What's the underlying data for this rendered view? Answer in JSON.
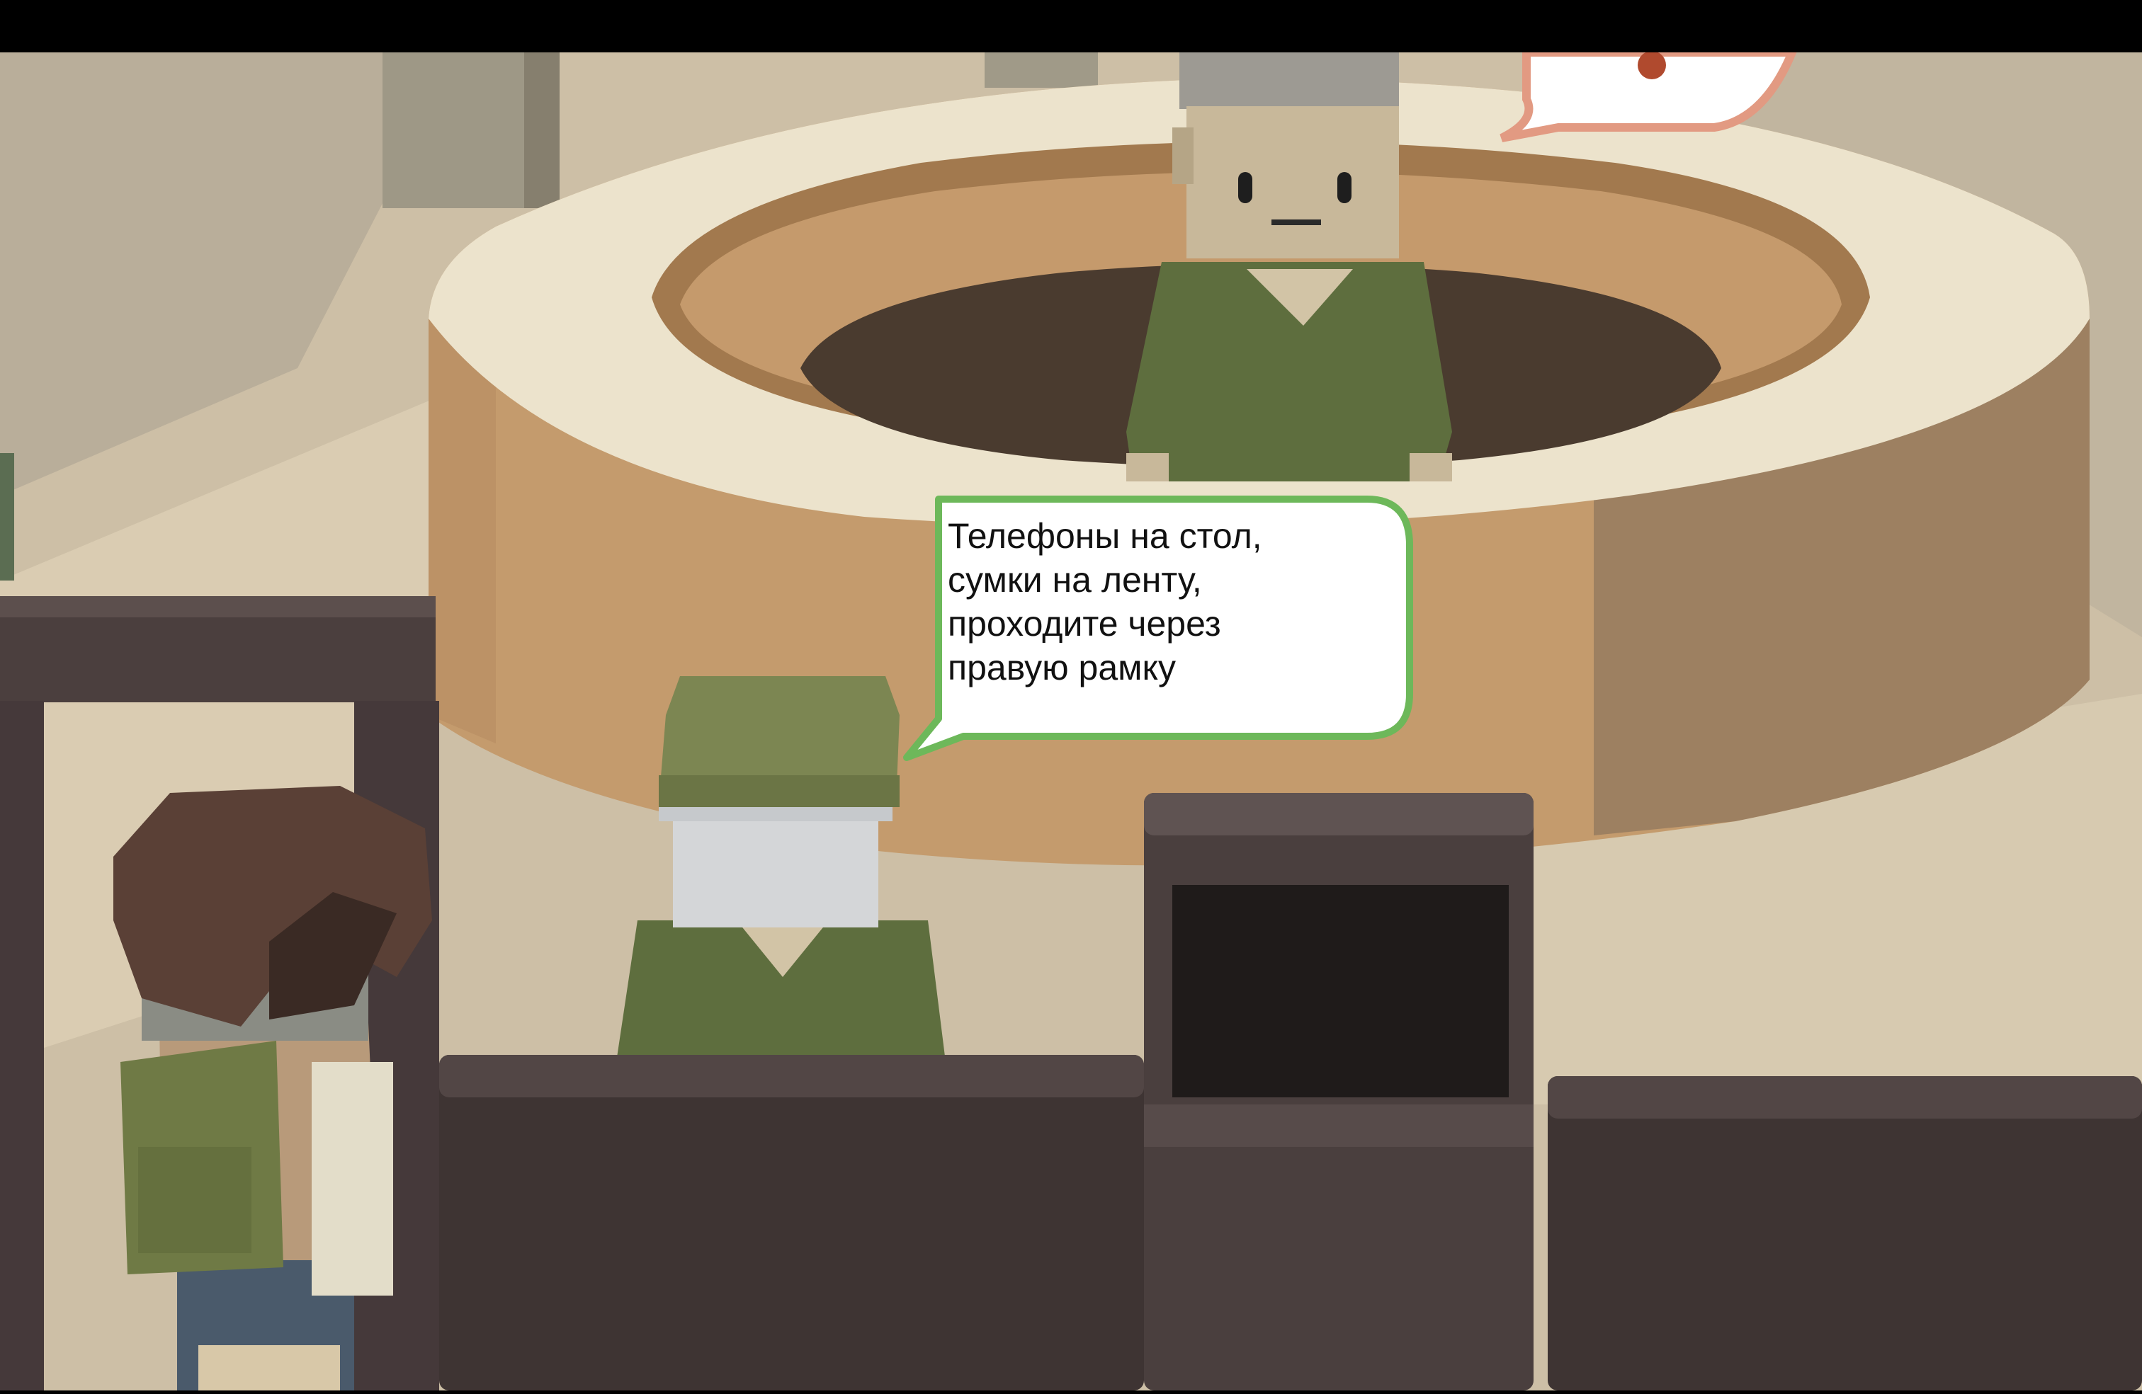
{
  "dialogue": {
    "speaker_bubble_lines": [
      "Телефоны на стол,",
      "сумки на ленту,",
      "проходите через",
      "правую рамку"
    ],
    "bubble_border_color": "#6db85a",
    "partial_bubble_border_color": "#e29a82"
  },
  "colors": {
    "letterbox": "#000000",
    "floor_light": "#d8c9ad",
    "desk_wood": "#c9a47a",
    "desk_top": "#efe8d4",
    "uniform_green": "#5e6e3e",
    "counter_dark": "#4a3f3e"
  }
}
